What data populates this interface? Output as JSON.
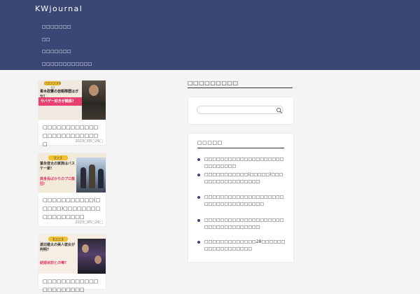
{
  "site": {
    "title": "KWjournal"
  },
  "nav": {
    "items": [
      {
        "label": "□□□□□□□"
      },
      {
        "label": "□□"
      },
      {
        "label": "□□□□□□□"
      },
      {
        "label": "□□□□□□□□□□□□"
      }
    ]
  },
  "posts": [
    {
      "thumb": {
        "chip": "□□□□□(なら)",
        "line1": "青木政憲の自衛隊歴はガセ!",
        "band": "サバゲー好きが関係?"
      },
      "title": "□□□□□□□□□□□□□□□□□□□□□□□□□",
      "date": "2023□05□26□"
    },
    {
      "thumb": {
        "chip": "【□□】",
        "line1": "富永啓太の家族はバスケ一家!",
        "line2": "高身長ばかりのプロ集団!"
      },
      "title": "□□□□□□□□□□□(□□□□□)□□□□□□□□□□□□□□□□□",
      "date": "2023□05□26□"
    },
    {
      "thumb": {
        "chip": "【□□□】",
        "line1": "渡辺雄太の美人彼女が判明?",
        "line2": "結婚目前との噂?"
      },
      "title": "□□□□□□□□□□□□□□□□□□□□□"
    }
  ],
  "sidebar": {
    "search": {
      "title": "□□□□□□□□□",
      "placeholder": ""
    },
    "recent": {
      "title": "□□□□□",
      "items": [
        {
          "label": "□□□□□□□□□□□□□□□□□□□□□□□□□□□□"
        },
        {
          "label": "□□□□□□□□□□□(□□□□□)□□□□□□□□□□□□□□□□□"
        },
        {
          "label": "□□□□□□□□□□□□□□□□□□□□□□□□□□□□□□□□□□□"
        },
        {
          "label": "□□□□□□□□□□□□□□□□□□□□□□□□□□□□□□□□□□"
        },
        {
          "label": "□□□□□□□□□□□□□28□□□□□□□□□□□□□□□□□□"
        }
      ]
    }
  },
  "colors": {
    "header": "#3a4775",
    "background": "#f4f4f4",
    "accent": "#3a4775"
  }
}
